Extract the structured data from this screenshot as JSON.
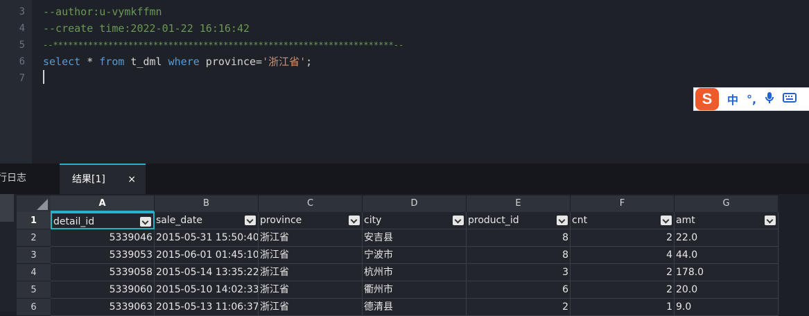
{
  "editor": {
    "line_numbers": [
      "3",
      "4",
      "5",
      "6",
      "7"
    ],
    "lines": {
      "l3": "--author:u-vymkffmn",
      "l4": "--create time:2022-01-22 16:16:42",
      "l5": "--********************************************************************--",
      "l6_select": "select",
      "l6_star": " * ",
      "l6_from": "from",
      "l6_table": " t_dml ",
      "l6_where": "where",
      "l6_cond": " province=",
      "l6_str": "'浙江省'",
      "l6_end": ";"
    }
  },
  "ime": {
    "logo": "S",
    "items": [
      "中",
      "°,",
      "🎤",
      "⌨"
    ]
  },
  "tabs": {
    "log_label": "行日志",
    "result_label": "结果[1]",
    "close_glyph": "×"
  },
  "grid": {
    "column_letters": [
      "A",
      "B",
      "C",
      "D",
      "E",
      "F",
      "G"
    ],
    "headers": [
      "detail_id",
      "sale_date",
      "province",
      "city",
      "product_id",
      "cnt",
      "amt"
    ],
    "row_numbers": [
      "1",
      "2",
      "3",
      "4",
      "5",
      "6"
    ],
    "rows": [
      [
        "5339046",
        "2015-05-31 15:50:40",
        "浙江省",
        "安吉县",
        "8",
        "2",
        "22.0"
      ],
      [
        "5339053",
        "2015-06-01 01:45:10",
        "浙江省",
        "宁波市",
        "8",
        "4",
        "44.0"
      ],
      [
        "5339058",
        "2015-05-14 13:35:22",
        "浙江省",
        "杭州市",
        "3",
        "2",
        "178.0"
      ],
      [
        "5339060",
        "2015-05-10 14:02:33",
        "浙江省",
        "衢州市",
        "6",
        "2",
        "20.0"
      ],
      [
        "5339063",
        "2015-05-13 11:06:37",
        "浙江省",
        "德清县",
        "2",
        "1",
        "9.0"
      ]
    ]
  },
  "colors": {
    "accent": "#26b3c7",
    "comment": "#6a9955",
    "keyword": "#569cd6",
    "string": "#ce9178"
  }
}
